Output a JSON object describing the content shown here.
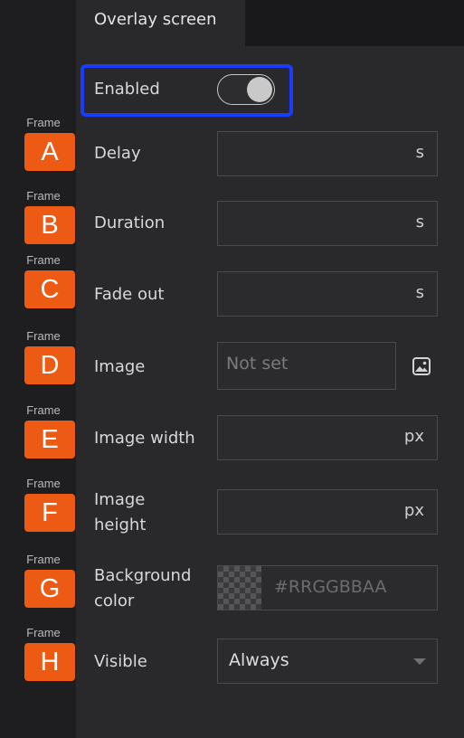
{
  "tab": {
    "label": "Overlay screen"
  },
  "enabled": {
    "label": "Enabled",
    "value": true
  },
  "frames": [
    {
      "caption": "Frame",
      "letter": "A"
    },
    {
      "caption": "Frame",
      "letter": "B"
    },
    {
      "caption": "Frame",
      "letter": "C"
    },
    {
      "caption": "Frame",
      "letter": "D"
    },
    {
      "caption": "Frame",
      "letter": "E"
    },
    {
      "caption": "Frame",
      "letter": "F"
    },
    {
      "caption": "Frame",
      "letter": "G"
    },
    {
      "caption": "Frame",
      "letter": "H"
    }
  ],
  "fields": {
    "delay": {
      "label": "Delay",
      "value": "",
      "unit": "s"
    },
    "duration": {
      "label": "Duration",
      "value": "",
      "unit": "s"
    },
    "fade_out": {
      "label": "Fade out",
      "value": "",
      "unit": "s"
    },
    "image": {
      "label": "Image",
      "placeholder": "Not set",
      "icon": "image-picker-icon"
    },
    "image_width": {
      "label": "Image width",
      "value": "",
      "unit": "px"
    },
    "image_height": {
      "label_line1": "Image",
      "label_line2": "height",
      "value": "",
      "unit": "px"
    },
    "background_color": {
      "label_line1": "Background",
      "label_line2": "color",
      "placeholder": "#RRGGBBAA"
    },
    "visible": {
      "label": "Visible",
      "selected": "Always"
    }
  },
  "colors": {
    "frame_tag": "#ec5a14",
    "highlight": "#1a3cff",
    "panel": "#29292b"
  }
}
